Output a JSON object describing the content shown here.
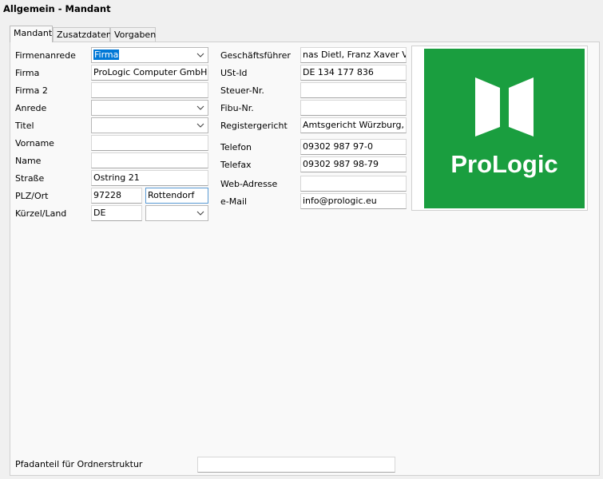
{
  "window": {
    "title": "Allgemein - Mandant"
  },
  "tabs": [
    {
      "label": "Mandant",
      "active": true
    },
    {
      "label": "Zusatzdaten",
      "active": false
    },
    {
      "label": "Vorgaben",
      "active": false
    }
  ],
  "left": {
    "firmenanrede": {
      "label": "Firmenanrede",
      "value": "Firma"
    },
    "firma": {
      "label": "Firma",
      "value": "ProLogic Computer GmbH"
    },
    "firma2": {
      "label": "Firma 2",
      "value": ""
    },
    "anrede": {
      "label": "Anrede",
      "value": ""
    },
    "titel": {
      "label": "Titel",
      "value": ""
    },
    "vorname": {
      "label": "Vorname",
      "value": ""
    },
    "name": {
      "label": "Name",
      "value": ""
    },
    "strasse": {
      "label": "Straße",
      "value": "Ostring 21"
    },
    "plz_ort": {
      "label": "PLZ/Ort",
      "plz": "97228",
      "ort": "Rottendorf"
    },
    "kuerzel_land": {
      "label": "Kürzel/Land",
      "kuerzel": "DE",
      "land": ""
    }
  },
  "right": {
    "geschaeftsfuehrer": {
      "label": "Geschäftsführer",
      "value": "nas Dietl, Franz Xaver Völkl"
    },
    "ust_id": {
      "label": "USt-Id",
      "value": "DE 134 177 836"
    },
    "steuer_nr": {
      "label": "Steuer-Nr.",
      "value": ""
    },
    "fibu_nr": {
      "label": "Fibu-Nr.",
      "value": ""
    },
    "registergericht": {
      "label": "Registergericht",
      "value": "Amtsgericht Würzburg, HR"
    },
    "telefon": {
      "label": "Telefon",
      "value": "09302 987 97-0"
    },
    "telefax": {
      "label": "Telefax",
      "value": "09302 987 98-79"
    },
    "web": {
      "label": "Web-Adresse",
      "value": ""
    },
    "email": {
      "label": "e-Mail",
      "value": "info@prologic.eu"
    }
  },
  "logo": {
    "text": "ProLogic",
    "bg_color": "#1a9e3f",
    "fg_color": "#ffffff"
  },
  "footer": {
    "pfad_label": "Pfadanteil für Ordnerstruktur",
    "pfad_value": ""
  },
  "icons": {
    "dropdown": "chevron-down-icon"
  }
}
